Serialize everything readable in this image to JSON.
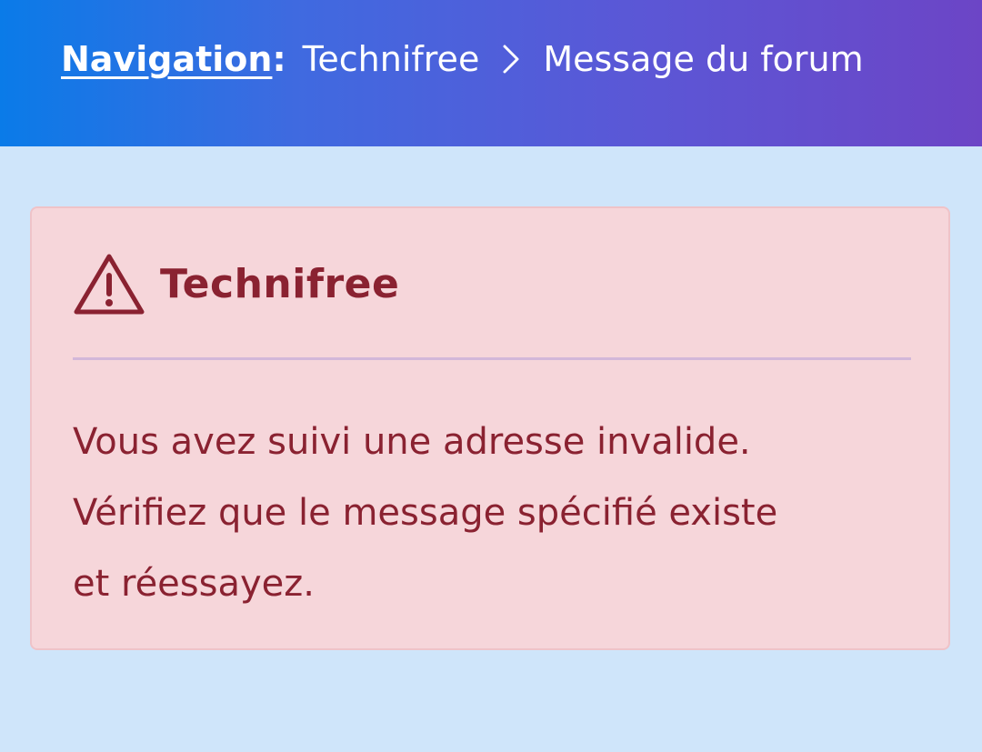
{
  "breadcrumb": {
    "nav_label": "Navigation",
    "colon": ":",
    "items": [
      "Technifree",
      "Message du forum"
    ]
  },
  "alert": {
    "icon": "warning-triangle-icon",
    "title": "Technifree",
    "lines": [
      "Vous avez suivi une adresse invalide.",
      "Vérifiez que le message spécifié existe",
      "et réessayez."
    ]
  },
  "colors": {
    "header_start": "#0a7be8",
    "header_end": "#6c45c6",
    "page_bg": "#cfe5fa",
    "alert_bg": "#f6d6da",
    "alert_text": "#8a2231"
  }
}
